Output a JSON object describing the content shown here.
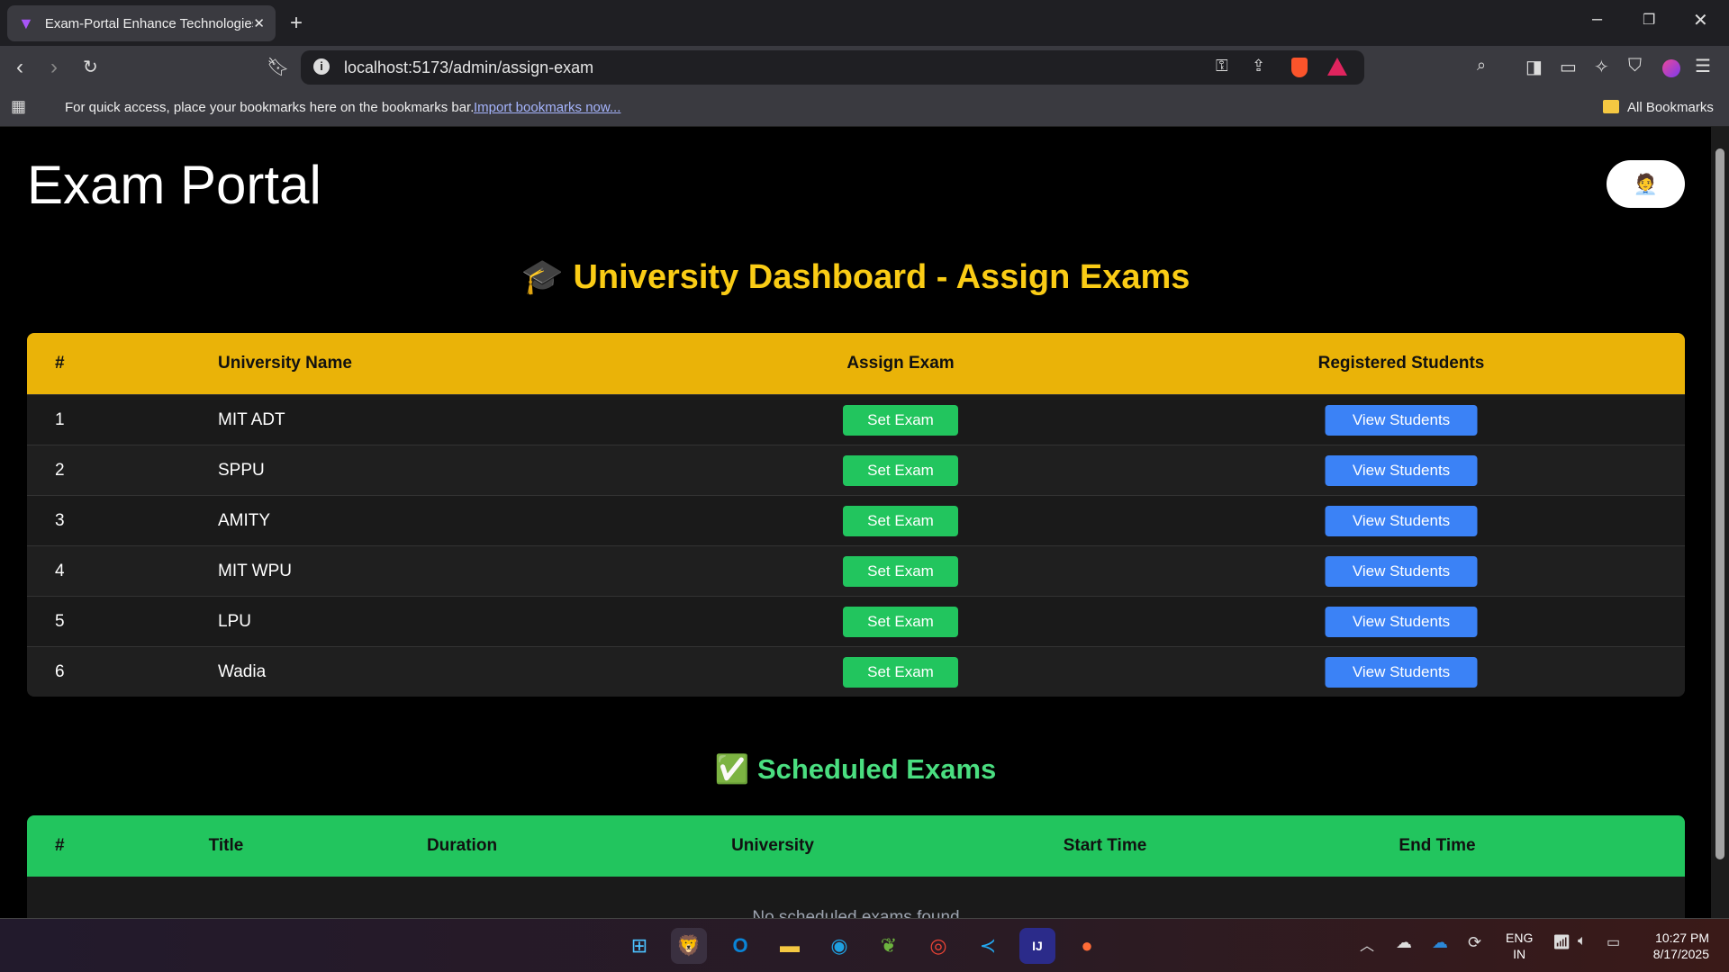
{
  "browser": {
    "tab_title": "Exam-Portal Enhance Technologies",
    "url": "localhost:5173/admin/assign-exam",
    "bookmarks_prompt": "For quick access, place your bookmarks here on the bookmarks bar.",
    "import_link": "Import bookmarks now...",
    "all_bookmarks": "All Bookmarks"
  },
  "app": {
    "title": "Exam Portal",
    "avatar": "🧑‍💼"
  },
  "assign": {
    "icon": "🎓",
    "heading": "University Dashboard - Assign Exams",
    "columns": [
      "#",
      "University Name",
      "Assign Exam",
      "Registered Students"
    ],
    "rows": [
      {
        "n": "1",
        "name": "MIT ADT"
      },
      {
        "n": "2",
        "name": "SPPU"
      },
      {
        "n": "3",
        "name": "AMITY"
      },
      {
        "n": "4",
        "name": "MIT WPU"
      },
      {
        "n": "5",
        "name": "LPU"
      },
      {
        "n": "6",
        "name": "Wadia"
      }
    ],
    "set_label": "Set Exam",
    "view_label": "View Students"
  },
  "scheduled": {
    "icon": "✅",
    "heading": "Scheduled Exams",
    "columns": [
      "#",
      "Title",
      "Duration",
      "University",
      "Start Time",
      "End Time"
    ],
    "empty": "No scheduled exams found"
  },
  "taskbar": {
    "lang": "ENG",
    "region": "IN",
    "time": "10:27 PM",
    "date": "8/17/2025"
  },
  "colors": {
    "yellow": "#eab308",
    "green": "#22c55e",
    "blue": "#3b82f6"
  }
}
